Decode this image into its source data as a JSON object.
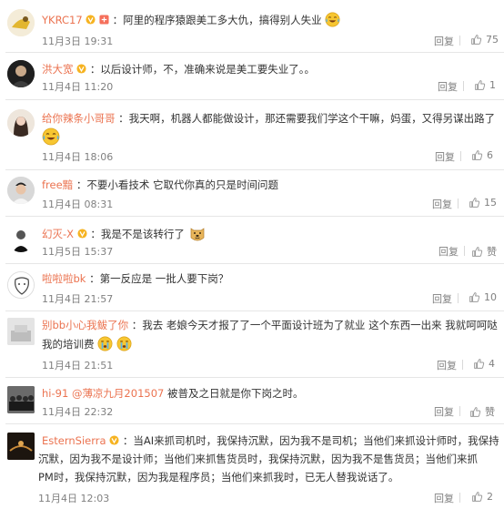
{
  "comments": [
    {
      "id": "ykrc17",
      "name": "YKRC17",
      "text": "：阿里的程序猿跟美工多大仇，搞得别人失业",
      "time": "11月3日 19:31",
      "reply": "回复",
      "likes": "75"
    },
    {
      "id": "hongdakuan",
      "name": "洪大宽",
      "text": "：以后设计师，不，准确来说是美工要失业了。。",
      "time": "11月4日 11:20",
      "reply": "回复",
      "likes": "1"
    },
    {
      "id": "geini",
      "name": "给你辣条小哥哥",
      "text": "：我天啊，机器人都能做设计，那还需要我们学这个干嘛，妈蛋，又得另谋出路了",
      "time": "11月4日 18:06",
      "reply": "回复",
      "likes": "6"
    },
    {
      "id": "free",
      "name": "free黯",
      "text": "：不要小看技术 它取代你真的只是时间问题",
      "time": "11月4日 08:31",
      "reply": "回复",
      "likes": "15"
    },
    {
      "id": "huanmie",
      "name": "幻灭-X",
      "text": "：我是不是该转行了",
      "time": "11月5日 15:37",
      "reply": "回复",
      "likes": "赞"
    },
    {
      "id": "lalala",
      "name": "啦啦啦bk",
      "text": "：第一反应是 一批人要下岗？",
      "time": "11月4日 21:57",
      "reply": "回复",
      "likes": "10"
    },
    {
      "id": "bieb",
      "name": "别bb小心我鲅了你",
      "text": "：我去 老娘今天才报了了一个平面设计班为了就业 这个东西一出来 我就呵呵哒",
      "text2": "我的培训费",
      "time": "11月4日 21:51",
      "reply": "回复",
      "likes": "4"
    },
    {
      "id": "hi91",
      "name": "hi-91",
      "mention": "@薄凉九月201507",
      "text": " 被普及之日就是你下岗之时。",
      "time": "11月4日 22:32",
      "reply": "回复",
      "likes": "赞"
    },
    {
      "id": "estern",
      "name": "EsternSierra",
      "text": "：当AI来抓司机时，我保持沉默，因为我不是司机；当他们来抓设计师时，我保持",
      "text2": "沉默，因为我不是设计师；当他们来抓售货员时，我保持沉默，因为我不是售货员；当他们来抓",
      "text3": "PM时，我保持沉默，因为我是程序员；当他们来抓我时，已无人替我说话了。",
      "time": "11月4日 12:03",
      "reply": "回复",
      "likes": "2"
    }
  ],
  "colors": {
    "name": "#eb7350",
    "meta": "#808080",
    "text": "#333333",
    "divider": "#e6e6e6"
  },
  "icons": [
    "thumbs-up-icon",
    "vip-badge-icon",
    "weibo-level-icon",
    "laughing-crying-emoji-icon",
    "doge-emoji-icon",
    "sad-crying-emoji-icon"
  ]
}
